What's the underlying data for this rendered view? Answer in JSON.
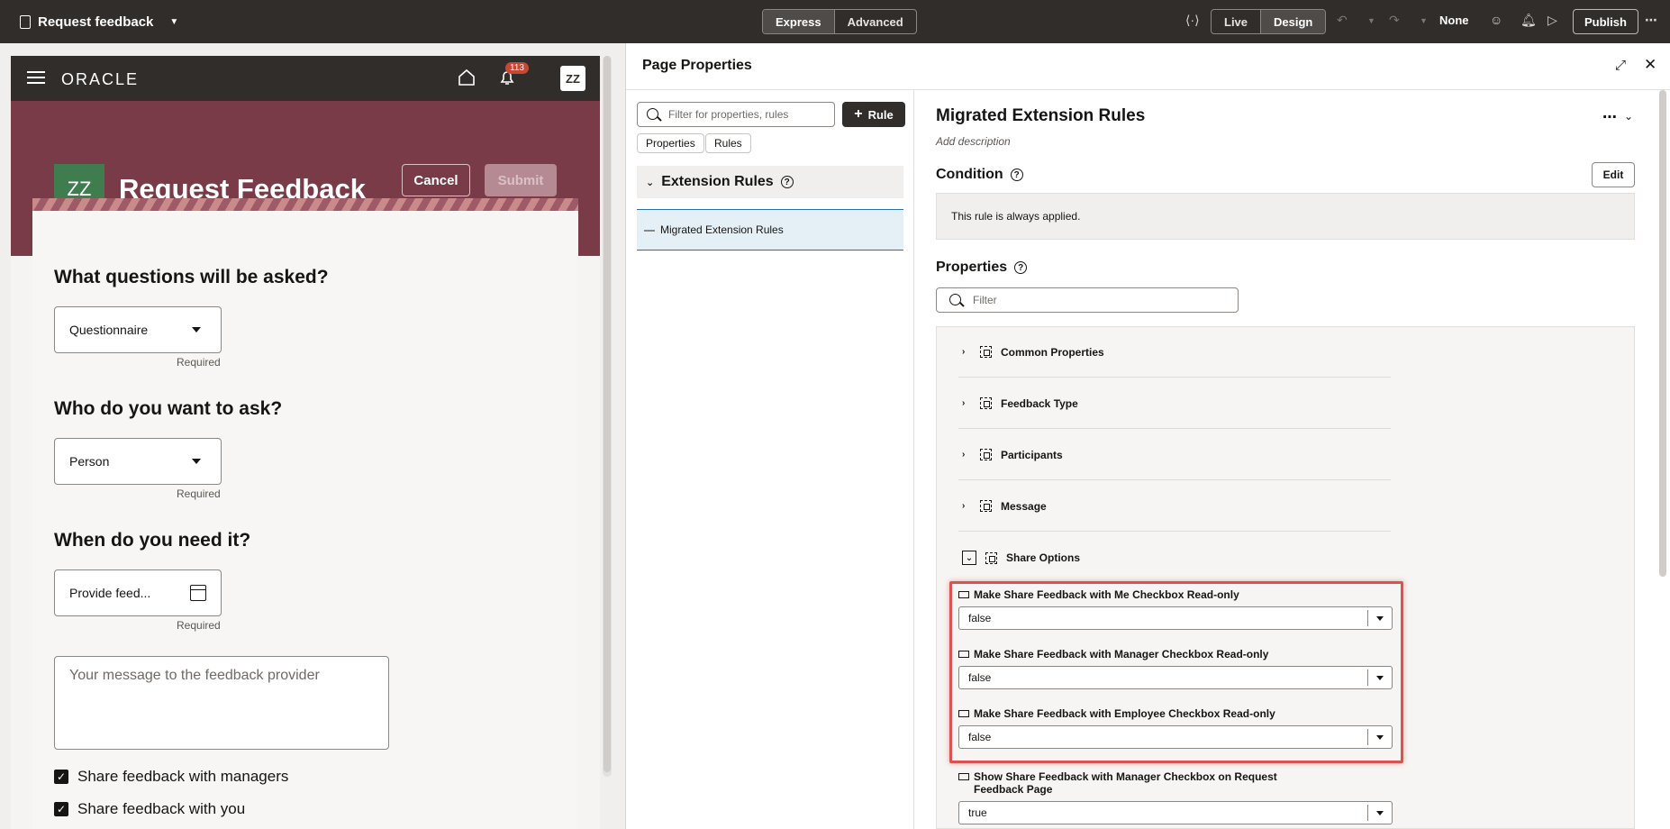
{
  "topbar": {
    "page_name": "Request feedback",
    "mode_express": "Express",
    "mode_advanced": "Advanced",
    "view_live": "Live",
    "view_design": "Design",
    "sandbox": "None",
    "publish": "Publish"
  },
  "preview": {
    "brand": "ORACLE",
    "notification_count": "113",
    "user_initials": "ZZ",
    "title": "Request Feedback",
    "cancel": "Cancel",
    "submit": "Submit",
    "q1": "What questions will be asked?",
    "q1_value": "Questionnaire",
    "q2": "Who do you want to ask?",
    "q2_value": "Person",
    "q3": "When do you need it?",
    "q3_placeholder": "Provide feed...",
    "required": "Required",
    "message_placeholder": "Your message to the feedback provider",
    "share_managers": "Share feedback with managers",
    "share_you": "Share feedback with you"
  },
  "drawer": {
    "title": "Page Properties",
    "search_placeholder": "Filter for properties, rules",
    "rule_button": "Rule",
    "tab_properties": "Properties",
    "tab_rules": "Rules",
    "section": "Extension Rules",
    "rule_item": "Migrated Extension Rules"
  },
  "detail": {
    "title": "Migrated Extension Rules",
    "add_description": "Add description",
    "condition": "Condition",
    "edit": "Edit",
    "condition_text": "This rule is always applied.",
    "properties": "Properties",
    "filter_placeholder": "Filter",
    "groups": [
      "Common Properties",
      "Feedback Type",
      "Participants",
      "Message",
      "Share Options"
    ],
    "props": [
      {
        "label": "Make Share Feedback with Me Checkbox Read-only",
        "value": "false"
      },
      {
        "label": "Make Share Feedback with Manager Checkbox Read-only",
        "value": "false"
      },
      {
        "label": "Make Share Feedback with Employee Checkbox Read-only",
        "value": "false"
      },
      {
        "label": "Show Share Feedback with Manager Checkbox on Request Feedback Page",
        "value": "true"
      }
    ]
  },
  "colors": {
    "topbar": "#312d2a",
    "hero": "#7a3b48",
    "highlight": "#d9534f",
    "selected": "#e4eff6"
  }
}
